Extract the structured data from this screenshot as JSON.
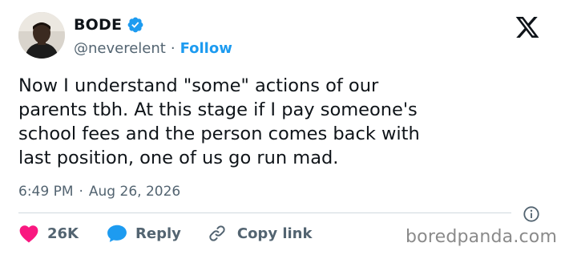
{
  "author": {
    "name": "BODE",
    "handle": "@neverelent",
    "separator": "·",
    "follow_label": "Follow",
    "avatar_icon": "person-avatar-icon",
    "verified_icon": "verified-badge-icon",
    "verified_color": "#1d9bf0"
  },
  "platform_logo": "x-logo-icon",
  "tweet": {
    "lines": [
      "Now I understand \"some\" actions of our",
      "parents tbh. At this stage if I pay someone's",
      "school fees and the person comes back with",
      "last position, one of us go run mad."
    ]
  },
  "meta": {
    "time": "6:49 PM",
    "separator": "·",
    "date": "Aug 26, 2026",
    "info_icon": "info-icon"
  },
  "actions": {
    "like_count": "26K",
    "like_icon": "heart-icon",
    "like_color": "#f91880",
    "reply_label": "Reply",
    "reply_icon": "speech-bubble-icon",
    "reply_color": "#1d9bf0",
    "copy_label": "Copy link",
    "copy_icon": "link-icon"
  },
  "watermark": "boredpanda.com"
}
